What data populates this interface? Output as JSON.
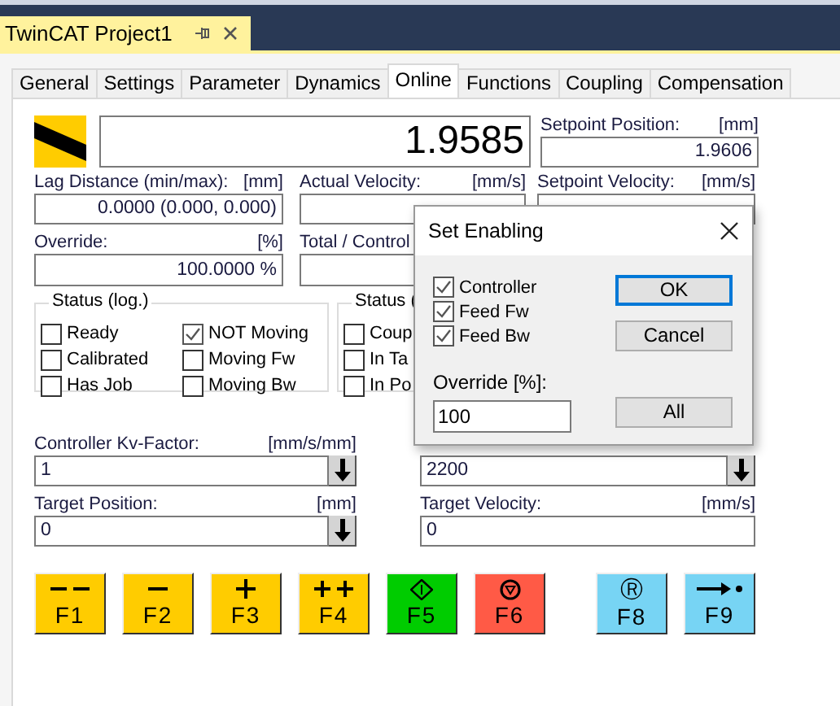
{
  "document_tab": {
    "title": "TwinCAT Project1"
  },
  "tabs": [
    {
      "label": "General",
      "selected": false
    },
    {
      "label": "Settings",
      "selected": false
    },
    {
      "label": "Parameter",
      "selected": false
    },
    {
      "label": "Dynamics",
      "selected": false
    },
    {
      "label": "Online",
      "selected": true
    },
    {
      "label": "Functions",
      "selected": false
    },
    {
      "label": "Coupling",
      "selected": false
    },
    {
      "label": "Compensation",
      "selected": false
    }
  ],
  "position": {
    "value": "1.9585"
  },
  "setpoint_position": {
    "label": "Setpoint Position:",
    "unit": "[mm]",
    "value": "1.9606"
  },
  "lag_distance": {
    "label": "Lag Distance (min/max):",
    "unit": "[mm]",
    "value": "0.0000  (0.000, 0.000)"
  },
  "actual_velocity": {
    "label": "Actual Velocity:",
    "unit": "[mm/s]"
  },
  "setpoint_velocity": {
    "label": "Setpoint Velocity:",
    "unit": "[mm/s]"
  },
  "override": {
    "label": "Override:",
    "unit": "[%]",
    "value": "100.0000 %"
  },
  "total_control": {
    "label": "Total / Control"
  },
  "status_log": {
    "title": "Status (log.)",
    "items": [
      {
        "label": "Ready",
        "checked": false
      },
      {
        "label": "Calibrated",
        "checked": false
      },
      {
        "label": "Has Job",
        "checked": false
      },
      {
        "label": "NOT Moving",
        "checked": true
      },
      {
        "label": "Moving Fw",
        "checked": false
      },
      {
        "label": "Moving Bw",
        "checked": false
      }
    ]
  },
  "status_phys": {
    "title": "Status (",
    "items": [
      {
        "label": "Coup",
        "checked": false
      },
      {
        "label": "In Ta",
        "checked": false
      },
      {
        "label": "In Po",
        "checked": false
      }
    ]
  },
  "kv_factor": {
    "label": "Controller Kv-Factor:",
    "unit": "[mm/s/mm]",
    "value": "1"
  },
  "column_2_field": {
    "value": "2200"
  },
  "target_position": {
    "label": "Target Position:",
    "unit": "[mm]",
    "value": "0"
  },
  "target_velocity": {
    "label": "Target Velocity:",
    "unit": "[mm/s]",
    "value": "0"
  },
  "function_keys": [
    {
      "label": "F1",
      "kind": "double-minus",
      "color": "#ffcc00",
      "separated": false
    },
    {
      "label": "F2",
      "kind": "minus",
      "color": "#ffcc00",
      "separated": false
    },
    {
      "label": "F3",
      "kind": "plus",
      "color": "#ffcc00",
      "separated": false
    },
    {
      "label": "F4",
      "kind": "double-plus",
      "color": "#ffcc00",
      "separated": false
    },
    {
      "label": "F5",
      "kind": "diamond",
      "color": "#00cc00",
      "separated": false
    },
    {
      "label": "F6",
      "kind": "stop",
      "color": "#ff5a46",
      "separated": false
    },
    {
      "label": "F8",
      "kind": "glyph",
      "symbol": "Ⓡ",
      "color": "#77d4f4",
      "separated": true
    },
    {
      "label": "F9",
      "kind": "arrow-dot",
      "color": "#77d4f4",
      "separated": false
    }
  ],
  "dialog": {
    "title": "Set Enabling",
    "checkboxes": [
      {
        "label": "Controller",
        "checked": true
      },
      {
        "label": "Feed Fw",
        "checked": true
      },
      {
        "label": "Feed Bw",
        "checked": true
      }
    ],
    "override_label": "Override [%]:",
    "override_value": "100",
    "buttons": [
      {
        "label": "OK",
        "focused": true
      },
      {
        "label": "Cancel",
        "focused": false
      },
      {
        "label": "All",
        "focused": false
      }
    ]
  }
}
